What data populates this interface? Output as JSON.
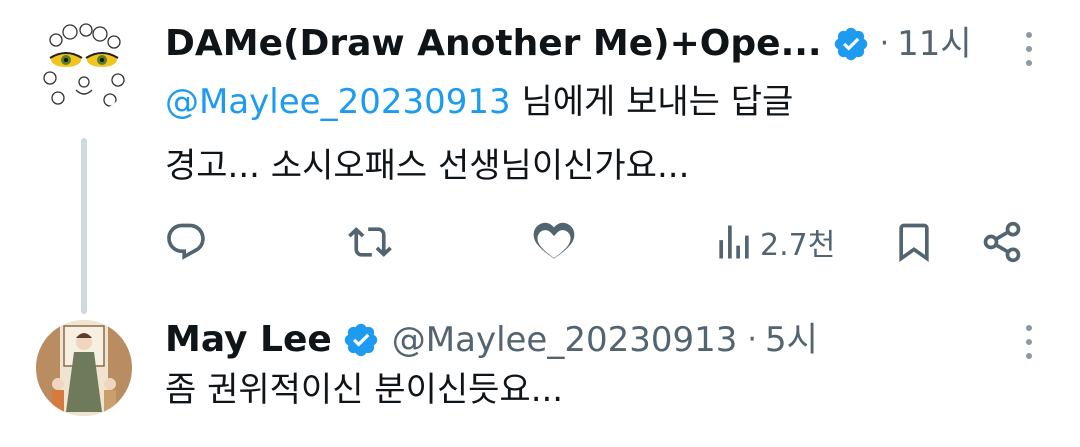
{
  "tweets": [
    {
      "display_name": "DAMe(Draw Another Me)+Ope...",
      "time": "11시",
      "dot": "·",
      "reply_to_handle": "@Maylee_20230913",
      "reply_to_suffix": " 님에게 보내는 답글",
      "text": "경고... 소시오패스 선생님이신가요...",
      "views": "2.7천",
      "avatar_icon": "flower-eyes-artwork"
    },
    {
      "display_name": "May Lee",
      "handle": "@Maylee_20230913",
      "dot": "·",
      "time": "5시",
      "text": "좀 권위적이신 분이신듯요...",
      "avatar_icon": "illustrated-woman-with-children"
    }
  ],
  "colors": {
    "text": "#0f1419",
    "secondary": "#536471",
    "link": "#1d9bf0",
    "verified_badge": "#1d9bf0",
    "thread_line": "#cfd9de"
  },
  "icons": [
    "reply-icon",
    "retweet-icon",
    "like-icon",
    "views-icon",
    "bookmark-icon",
    "share-icon",
    "more-icon",
    "verified-badge-icon"
  ]
}
